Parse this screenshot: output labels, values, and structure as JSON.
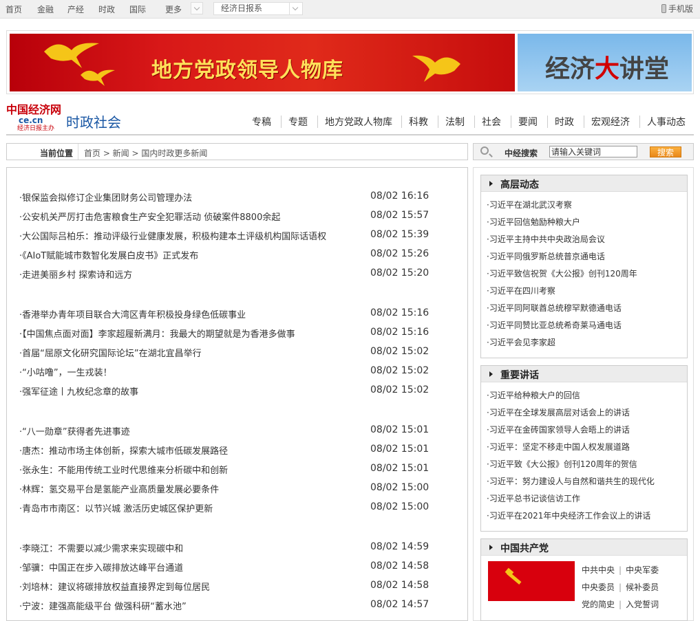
{
  "topbar": {
    "nav": [
      "首页",
      "金融",
      "产经",
      "时政",
      "国际",
      "更多"
    ],
    "select_value": "经济日报系",
    "mobile_label": "手机版"
  },
  "banner": {
    "main_title": "地方党政领导人物库",
    "side_logo": [
      "经济",
      "大",
      "讲堂"
    ]
  },
  "header": {
    "logo_line1": "中国经济网",
    "logo_line2": "ce.cn",
    "logo_line3": "经济日报主办",
    "channel": "时政社会",
    "nav": [
      "专稿",
      "专题",
      "地方党政人物库",
      "科教",
      "法制",
      "社会",
      "要闻",
      "时政",
      "宏观经济",
      "人事动态"
    ]
  },
  "breadcrumb": {
    "label": "当前位置",
    "path": "首页 > 新闻 > 国内时政更多新闻"
  },
  "search": {
    "label": "中经搜索",
    "value": "请输入关键词",
    "button": "搜索"
  },
  "news": [
    {
      "title": "·银保监会拟修订企业集团财务公司管理办法",
      "date": "08/02 16:16"
    },
    {
      "title": "·公安机关严厉打击危害粮食生产安全犯罪活动 侦破案件8800余起",
      "date": "08/02 15:57"
    },
    {
      "title": "·大公国际吕柏乐：推动评级行业健康发展，积极构建本土评级机构国际话语权",
      "date": "08/02 15:39"
    },
    {
      "title": "·《AIoT赋能城市数智化发展白皮书》正式发布",
      "date": "08/02 15:26"
    },
    {
      "title": "·走进美丽乡村 探索诗和远方",
      "date": "08/02 15:20"
    },
    {
      "title": "·香港举办青年项目联合大湾区青年积极投身绿色低碳事业",
      "date": "08/02 15:16"
    },
    {
      "title": "·【中国焦点面对面】李家超履新满月：我最大的期望就是为香港多做事",
      "date": "08/02 15:16"
    },
    {
      "title": "·首届“屈原文化研究国际论坛”在湖北宜昌举行",
      "date": "08/02 15:02"
    },
    {
      "title": "·“小咕噜”，一生戎装！",
      "date": "08/02 15:02"
    },
    {
      "title": "·强军征途丨九枚纪念章的故事",
      "date": "08/02 15:02"
    },
    {
      "title": "·“八一勋章”获得者先进事迹",
      "date": "08/02 15:01"
    },
    {
      "title": "·唐杰：推动市场主体创新，探索大城市低碳发展路径",
      "date": "08/02 15:01"
    },
    {
      "title": "·张永生：不能用传统工业时代思维来分析碳中和创新",
      "date": "08/02 15:01"
    },
    {
      "title": "·林辉：氢交易平台是氢能产业高质量发展必要条件",
      "date": "08/02 15:00"
    },
    {
      "title": "·青岛市市南区：以节兴城 激活历史城区保护更新",
      "date": "08/02 15:00"
    },
    {
      "title": "·李晓江：不需要以减少需求来实现碳中和",
      "date": "08/02 14:59"
    },
    {
      "title": "·邹骥：中国正在步入碳排放达峰平台通道",
      "date": "08/02 14:58"
    },
    {
      "title": "·刘培林：建议将碳排放权益直接界定到每位居民",
      "date": "08/02 14:58"
    },
    {
      "title": "·宁波：建强高能级平台 做强科研“蓄水池”",
      "date": "08/02 14:57"
    }
  ],
  "sidebar": {
    "panels": [
      {
        "title": "高层动态",
        "items": [
          "·习近平在湖北武汉考察",
          "·习近平回信勉励种粮大户",
          "·习近平主持中共中央政治局会议",
          "·习近平同俄罗斯总统普京通电话",
          "·习近平致信祝贺《大公报》创刊120周年",
          "·习近平在四川考察",
          "·习近平同阿联酋总统穆罕默德通电话",
          "·习近平同赞比亚总统希奇莱马通电话",
          "·习近平会见李家超"
        ]
      },
      {
        "title": "重要讲话",
        "items": [
          "·习近平给种粮大户的回信",
          "·习近平在全球发展高层对话会上的讲话",
          "·习近平在金砖国家领导人会晤上的讲话",
          "·习近平：坚定不移走中国人权发展道路",
          "·习近平致《大公报》创刊120周年的贺信",
          "·习近平：努力建设人与自然和谐共生的现代化",
          "·习近平总书记谈信访工作",
          "·习近平在2021年中央经济工作会议上的讲话"
        ]
      }
    ],
    "party": {
      "title": "中国共产党",
      "links": [
        [
          "中共中央",
          "中央军委"
        ],
        [
          "中央委员",
          "候补委员"
        ],
        [
          "党的简史",
          "入党誓词"
        ]
      ]
    }
  },
  "colors": {
    "banner_red": "#d81818",
    "banner_text": "#ffe05a",
    "channel_blue": "#1a57a4",
    "search_button": "#f0961f",
    "party_red": "#d8000d"
  }
}
